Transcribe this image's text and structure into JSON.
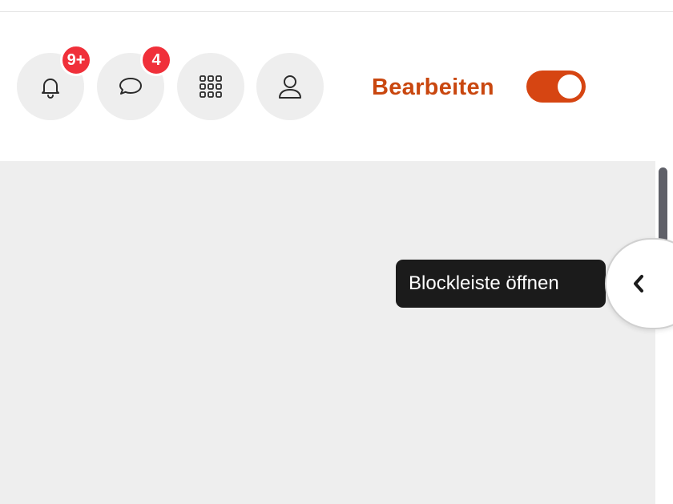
{
  "header": {
    "notifications": {
      "icon": "bell-icon",
      "badge": "9+"
    },
    "messages": {
      "icon": "chat-bubble-icon",
      "badge": "4"
    },
    "apps": {
      "icon": "grid-icon"
    },
    "profile": {
      "icon": "user-icon"
    },
    "edit_mode": {
      "label": "Bearbeiten",
      "enabled": true
    }
  },
  "drawer": {
    "icon": "chevron-left-icon",
    "tooltip": "Blockleiste öffnen"
  },
  "colors": {
    "accent": "#d64512",
    "edit_label": "#c9470f",
    "badge": "#f0303a",
    "button_bg": "#eeeeee",
    "content_bg": "#eeeeee",
    "tooltip_bg": "#1b1b1b"
  }
}
